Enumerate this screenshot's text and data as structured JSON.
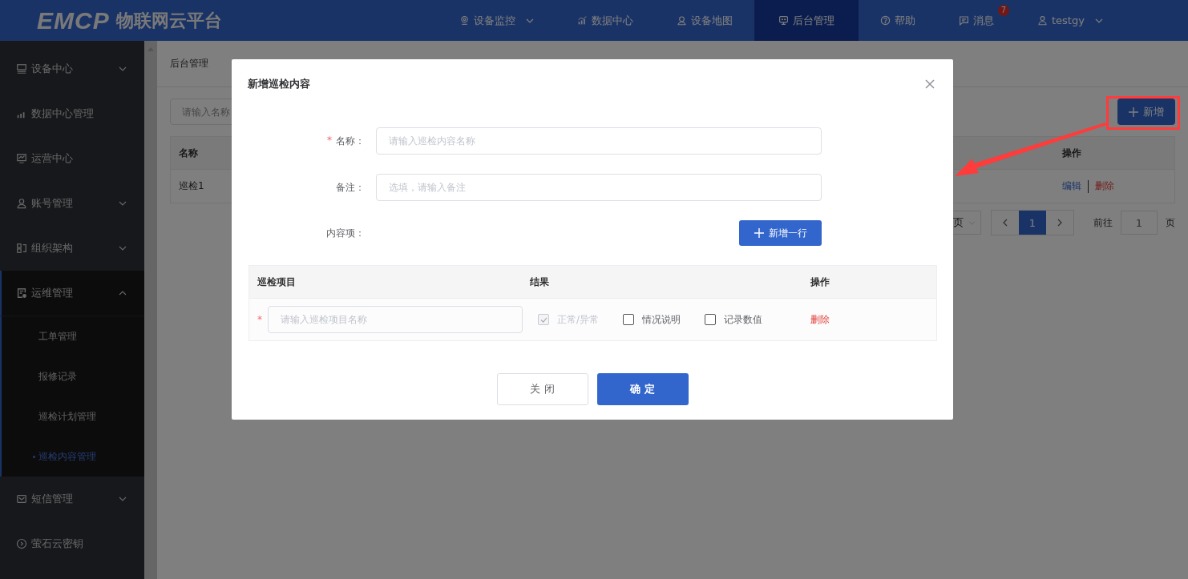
{
  "header": {
    "logo": "EMCP",
    "title": "物联网云平台",
    "nav": [
      {
        "label": "设备监控",
        "selected": false,
        "dropdown": true
      },
      {
        "label": "数据中心",
        "selected": false
      },
      {
        "label": "设备地图",
        "selected": false
      },
      {
        "label": "后台管理",
        "selected": true
      },
      {
        "label": "帮助",
        "selected": false
      },
      {
        "label": "消息",
        "selected": false,
        "badge": "7"
      },
      {
        "label": "testgy",
        "selected": false,
        "dropdown": true
      }
    ]
  },
  "sidebar": {
    "items": [
      {
        "label": "设备中心",
        "expanded": false
      },
      {
        "label": "数据中心管理"
      },
      {
        "label": "运营中心"
      },
      {
        "label": "账号管理",
        "expanded": false
      },
      {
        "label": "组织架构",
        "expanded": false
      },
      {
        "label": "运维管理",
        "expanded": true,
        "children": [
          {
            "label": "工单管理",
            "selected": false
          },
          {
            "label": "报修记录",
            "selected": false
          },
          {
            "label": "巡检计划管理",
            "selected": false
          },
          {
            "label": "巡检内容管理",
            "selected": true
          }
        ]
      },
      {
        "label": "短信管理",
        "expanded": false
      },
      {
        "label": "萤石云密钥"
      }
    ]
  },
  "breadcrumb": [
    "后台管理"
  ],
  "search": {
    "placeholder": "请输入名称"
  },
  "add_button": "新增",
  "table": {
    "columns": [
      "名称",
      "操作"
    ],
    "rows": [
      {
        "name": "巡检1",
        "actions": [
          "编辑",
          "删除"
        ]
      }
    ]
  },
  "pagination": {
    "page_size_suffix": "页",
    "pages": [
      {
        "label": "1",
        "selected": true
      }
    ],
    "goto_label": "前往",
    "goto_value": "1",
    "goto_suffix": "页"
  },
  "dialog": {
    "title": "新增巡检内容",
    "fields": [
      {
        "label": "名称：",
        "required_mark": "*",
        "placeholder": "请输入巡检内容名称"
      },
      {
        "label": "备注：",
        "placeholder": "选填，请输入备注"
      }
    ],
    "items_label": "内容项：",
    "add_row_button": "新增一行",
    "table": {
      "columns": [
        "巡检项目",
        "结果",
        "操作"
      ],
      "rows": [
        {
          "required_mark": "*",
          "placeholder": "请输入巡检项目名称",
          "options": [
            {
              "label": "正常/异常",
              "checked": true,
              "disabled": true
            },
            {
              "label": "情况说明",
              "checked": false,
              "disabled": false
            },
            {
              "label": "记录数值",
              "checked": false,
              "disabled": false
            }
          ],
          "action": "删除"
        }
      ]
    },
    "buttons": [
      {
        "label": "关 闭",
        "kind": "default"
      },
      {
        "label": "确 定",
        "kind": "primary"
      }
    ]
  }
}
